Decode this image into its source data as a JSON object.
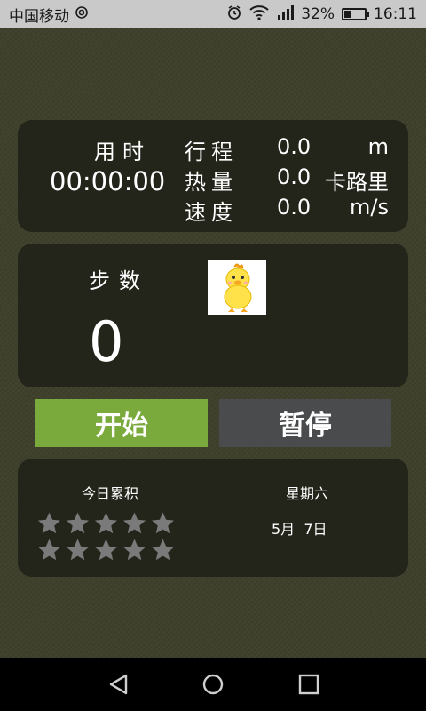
{
  "status_bar": {
    "carrier": "中国移动",
    "battery_percent": "32%",
    "time": "16:11",
    "icons": [
      "nfc-icon",
      "alarm-icon",
      "wifi-icon",
      "signal-icon",
      "battery-icon"
    ],
    "battery_level": 0.32
  },
  "summary": {
    "time_label": "用时",
    "time_value": "00:00:00",
    "stats": [
      {
        "label": "行程",
        "value": "0.0",
        "unit": "m"
      },
      {
        "label": "热量",
        "value": "0.0",
        "unit": "卡路里"
      },
      {
        "label": "速度",
        "value": "0.0",
        "unit": "m/s"
      }
    ]
  },
  "steps": {
    "label": "步数",
    "value": "0",
    "mascot": "duck-icon"
  },
  "buttons": {
    "start": "开始",
    "pause": "暂停"
  },
  "today": {
    "label": "今日累积",
    "rating": {
      "rows": 2,
      "per_row": 5,
      "filled": 0
    },
    "weekday": "星期六",
    "date": "5月  7日"
  },
  "nav": [
    "back-icon",
    "home-icon",
    "recents-icon"
  ],
  "colors": {
    "background": "#3e402b",
    "panel": "#23241a",
    "start_button": "#7aa93c",
    "pause_button": "#4a4b4d",
    "star": "#7a7a7a"
  }
}
